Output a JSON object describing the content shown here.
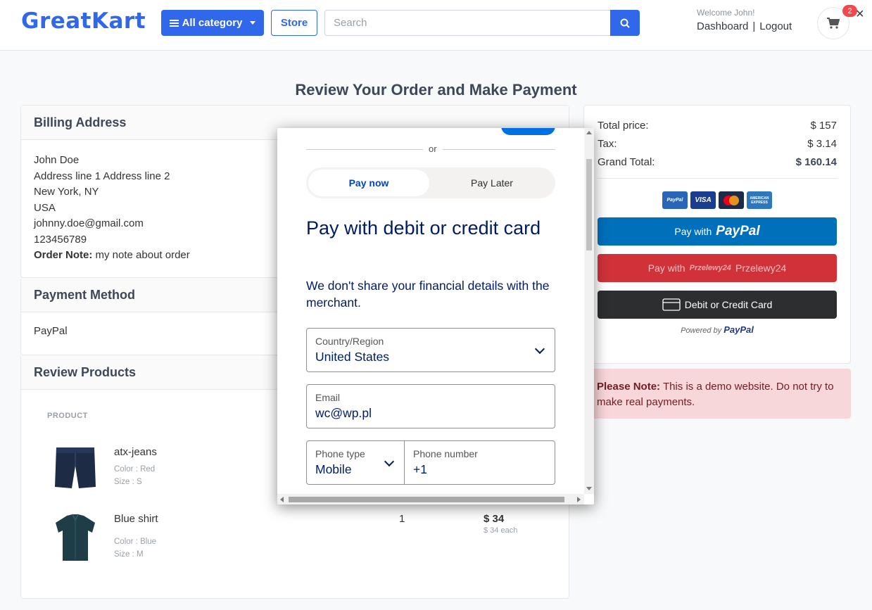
{
  "header": {
    "logo": "GreatKart",
    "category_button": "All category",
    "store_button": "Store",
    "search_placeholder": "Search",
    "welcome": "Welcome John!",
    "dashboard": "Dashboard",
    "separator": "|",
    "logout": "Logout",
    "cart_count": "2",
    "close": "×"
  },
  "page": {
    "title": "Review Your Order and Make Payment"
  },
  "billing": {
    "heading": "Billing Address",
    "name": "John Doe",
    "address": "Address line 1 Address line 2",
    "city": "New York, NY",
    "country": "USA",
    "email": "johnny.doe@gmail.com",
    "phone": "123456789",
    "note_label": "Order Note:",
    "note_value": "my note about order"
  },
  "payment_method": {
    "heading": "Payment Method",
    "value": "PayPal"
  },
  "review": {
    "heading": "Review Products",
    "column_product": "PRODUCT",
    "products": [
      {
        "name": "atx-jeans",
        "color": "Color : Red",
        "size": "Size : S",
        "qty": "",
        "price": "",
        "each": ""
      },
      {
        "name": "Blue shirt",
        "color": "Color : Blue",
        "size": "Size : M",
        "qty": "1",
        "price": "$ 34",
        "each": "$ 34 each"
      }
    ]
  },
  "summary": {
    "total_label": "Total price:",
    "total_value": "$ 157",
    "tax_label": "Tax:",
    "tax_value": "$ 3.14",
    "grand_label": "Grand Total:",
    "grand_value": "$ 160.14",
    "card_logos": [
      "PayPal",
      "VISA",
      "Mastercard",
      "AMERICAN EXPRESS"
    ],
    "paypal_prefix": "Pay with",
    "paypal_brand": "PayPal",
    "p24_prefix": "Pay with",
    "p24_brand": "Przelewy24",
    "p24_logo": "Przelewy24",
    "card_button": "Debit or Credit Card",
    "powered_by": "Powered by",
    "powered_brand": "PayPal",
    "colors": {
      "paypal": "#0070ba",
      "p24": "#d13239",
      "card": "#2c2e2f",
      "accent": "#3167eb"
    }
  },
  "notice": {
    "label": "Please Note:",
    "text": "This is a demo website. Do not try to make real payments."
  },
  "modal": {
    "or": "or",
    "tab_pay_now": "Pay now",
    "tab_pay_later": "Pay Later",
    "title": "Pay with debit or credit card",
    "subtitle": "We don't share your financial details with the merchant.",
    "country_label": "Country/Region",
    "country_value": "United States",
    "email_label": "Email",
    "email_value": "wc@wp.pl",
    "phone_type_label": "Phone type",
    "phone_type_value": "Mobile",
    "phone_label": "Phone number",
    "phone_value": "+1"
  }
}
